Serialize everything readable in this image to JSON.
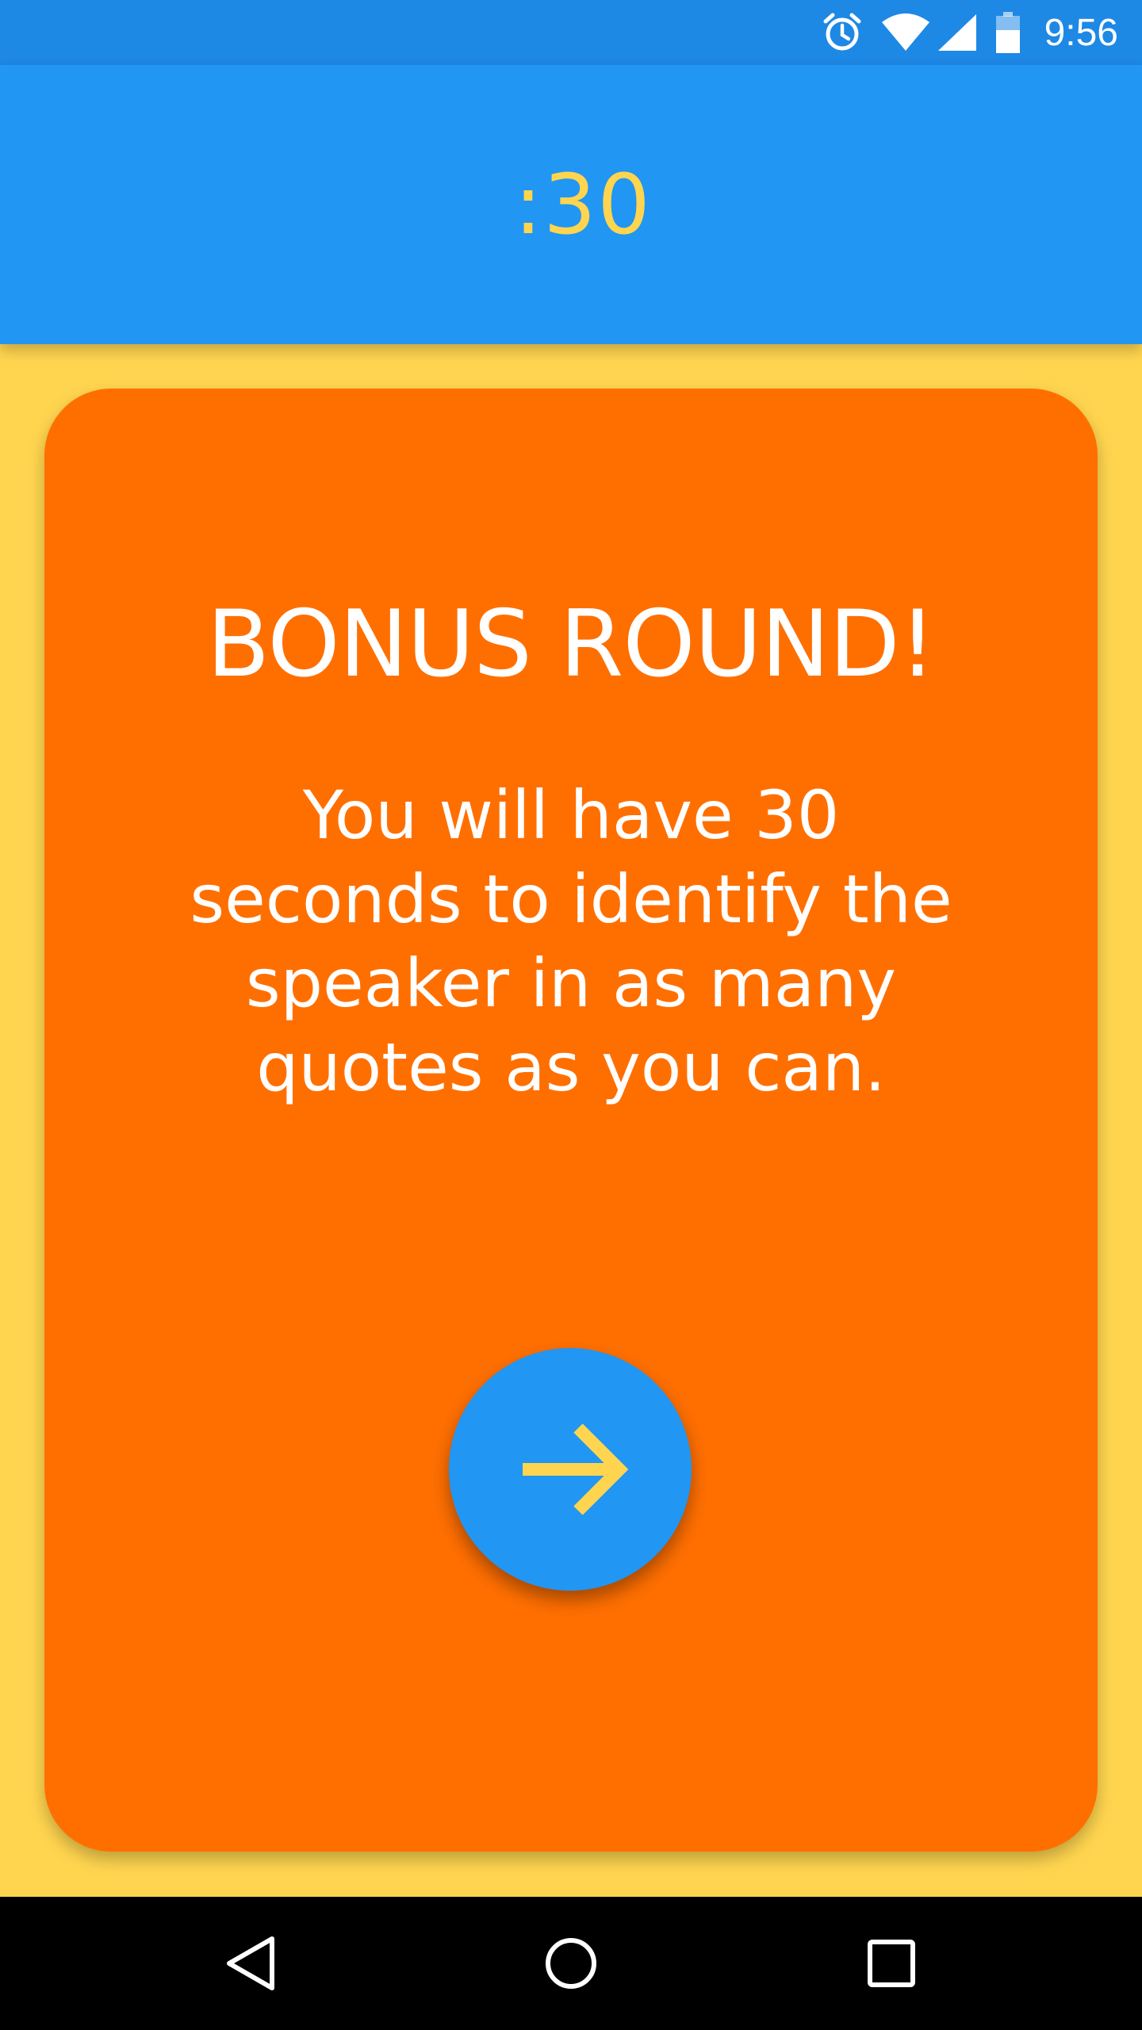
{
  "status_bar": {
    "time": "9:56",
    "icons": [
      "alarm-icon",
      "wifi-icon",
      "signal-icon",
      "battery-icon"
    ]
  },
  "app_bar": {
    "timer": ":30"
  },
  "card": {
    "title": "BONUS ROUND!",
    "body": "You will have 30 seconds to identify the speaker in as many quotes as you can.",
    "next_button_icon": "arrow-right-icon"
  },
  "nav_bar": {
    "icons": [
      "back-icon",
      "home-icon",
      "recents-icon"
    ]
  },
  "colors": {
    "status_bar": "#1E88E5",
    "app_bar": "#2196F3",
    "background": "#FFD54F",
    "card": "#FF6F00",
    "accent": "#FFD54F",
    "button": "#2196F3",
    "nav_bar": "#000000"
  }
}
